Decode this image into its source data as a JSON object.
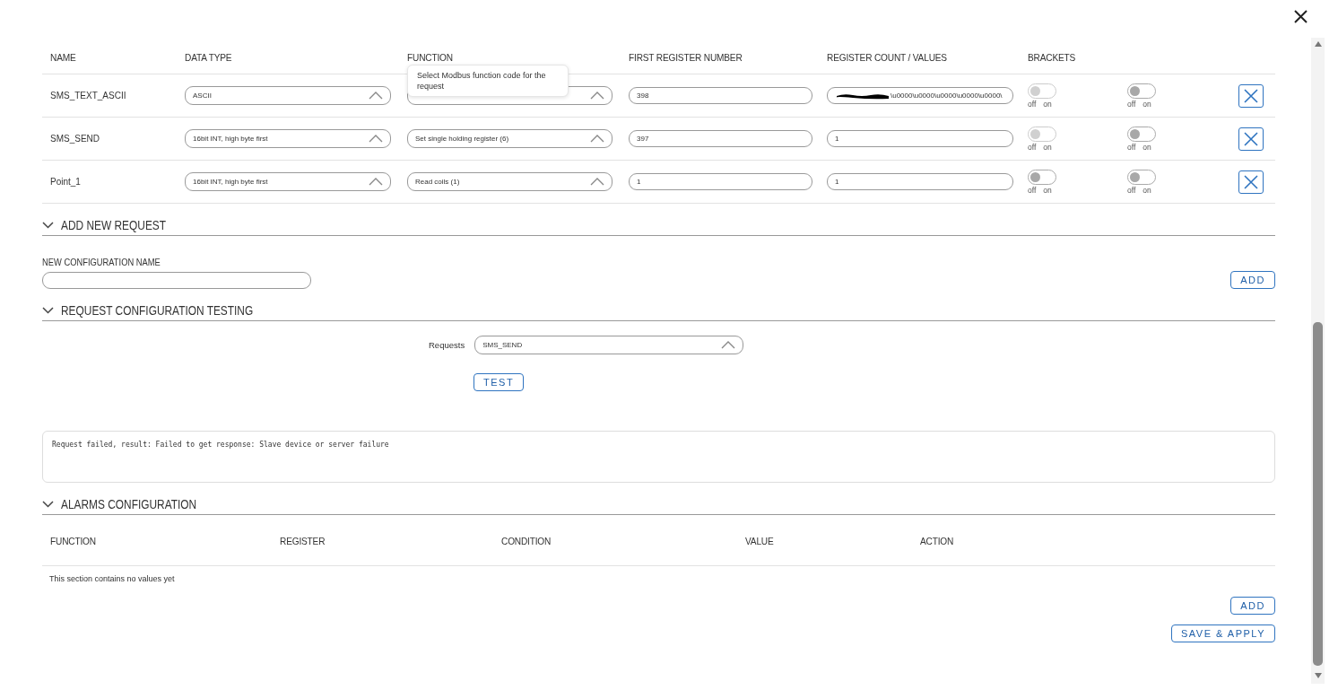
{
  "requests_table": {
    "columns": [
      "NAME",
      "DATA TYPE",
      "FUNCTION",
      "FIRST REGISTER NUMBER",
      "REGISTER COUNT / VALUES",
      "BRACKETS"
    ],
    "tooltip": "Select Modbus function code for the request",
    "rows": [
      {
        "name": "SMS_TEXT_ASCII",
        "data_type": "ASCII",
        "first_register": "398",
        "values": "\\u0000\\u0000\\u0000\\u0000\\u0000\\",
        "redacted": true,
        "toggles": [
          {
            "on": false,
            "disabled": true,
            "off_label": "off",
            "on_label": "on"
          },
          {
            "on": false,
            "disabled": false,
            "off_label": "off",
            "on_label": "on"
          }
        ]
      },
      {
        "name": "SMS_SEND",
        "data_type": "16bit INT, high byte first",
        "function": "Set single holding register (6)",
        "first_register": "397",
        "values": "1",
        "redacted": false,
        "toggles": [
          {
            "on": false,
            "disabled": true,
            "off_label": "off",
            "on_label": "on"
          },
          {
            "on": false,
            "disabled": false,
            "off_label": "off",
            "on_label": "on"
          }
        ]
      },
      {
        "name": "Point_1",
        "data_type": "16bit INT, high byte first",
        "function": "Read coils (1)",
        "first_register": "1",
        "values": "1",
        "redacted": false,
        "toggles": [
          {
            "on": false,
            "disabled": false,
            "off_label": "off",
            "on_label": "on"
          },
          {
            "on": false,
            "disabled": false,
            "off_label": "off",
            "on_label": "on"
          }
        ]
      }
    ]
  },
  "add_new_request": {
    "title": "ADD NEW REQUEST",
    "expanded": true,
    "field_label": "NEW CONFIGURATION NAME",
    "button": "ADD"
  },
  "request_testing": {
    "title": "REQUEST CONFIGURATION TESTING",
    "expanded": true,
    "requests_label": "Requests",
    "requests_value": "SMS_SEND",
    "button": "TEST",
    "output": "Request failed, result: Failed to get response: Slave device or server failure"
  },
  "alarms": {
    "title": "ALARMS CONFIGURATION",
    "expanded": true,
    "columns": [
      "FUNCTION",
      "REGISTER",
      "CONDITION",
      "VALUE",
      "ACTION"
    ],
    "empty_text": "This section contains no values yet",
    "button": "ADD"
  },
  "save_button": "SAVE & APPLY"
}
